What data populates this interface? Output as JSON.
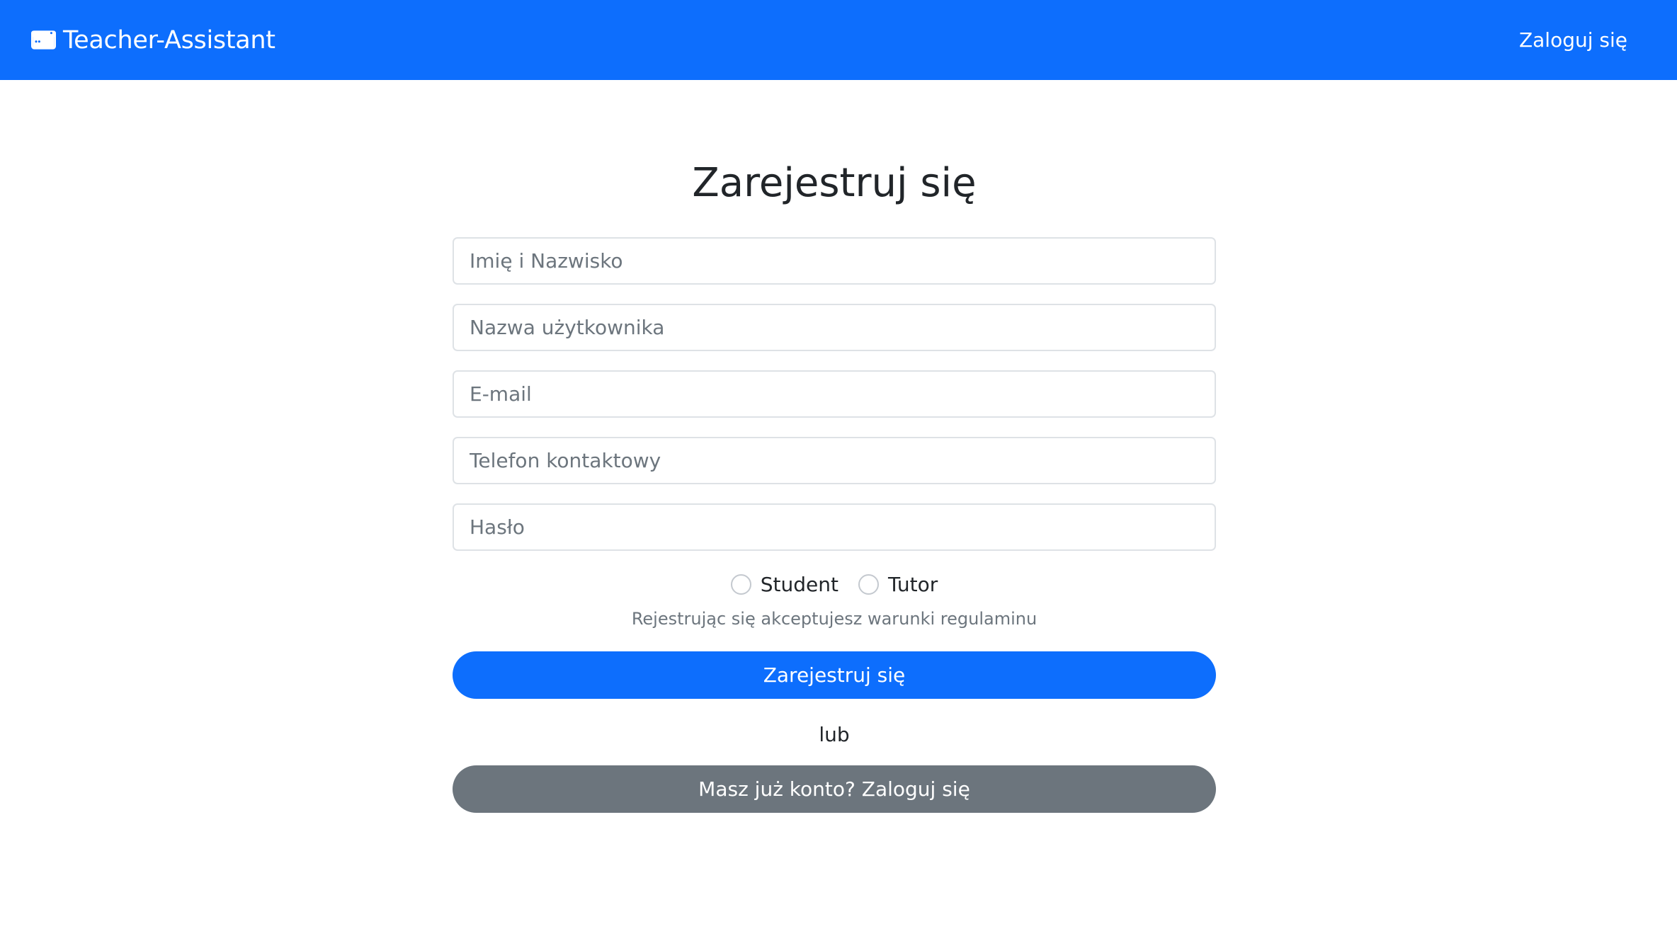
{
  "navbar": {
    "brand_icon": "browser-window-icon",
    "brand_name": "Teacher-Assistant",
    "login_link": "Zaloguj się",
    "background_color": "#0d6efd"
  },
  "form": {
    "title": "Zarejestruj się",
    "fields": {
      "full_name_placeholder": "Imię i Nazwisko",
      "username_placeholder": "Nazwa użytkownika",
      "email_placeholder": "E-mail",
      "phone_placeholder": "Telefon kontaktowy",
      "password_placeholder": "Hasło"
    },
    "roles": {
      "student_label": "Student",
      "tutor_label": "Tutor"
    },
    "terms_text": "Rejestrując się akceptujesz warunki regulaminu",
    "register_button": "Zarejestruj się",
    "or_text": "lub",
    "login_button": "Masz już konto? Zaloguj się"
  },
  "colors": {
    "primary": "#0d6efd",
    "secondary": "#6c757d",
    "muted_text": "#6c757d"
  }
}
